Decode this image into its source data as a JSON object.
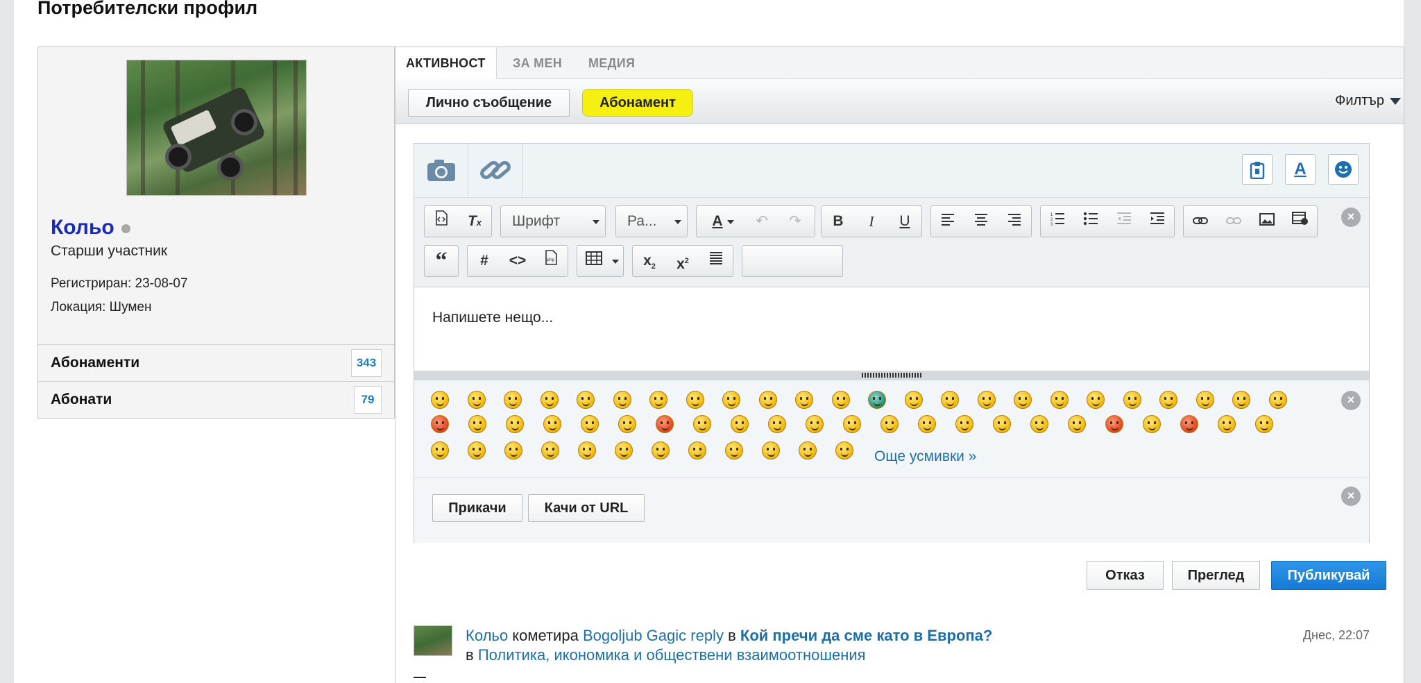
{
  "page": {
    "title": "Потребителски профил"
  },
  "profile": {
    "name": "Кольо",
    "rank": "Старши участник",
    "registered": "Регистриран: 23-08-07",
    "location": "Локация: Шумен",
    "stats": [
      {
        "label": "Абонаменти",
        "count": "343"
      },
      {
        "label": "Абонати",
        "count": "79"
      }
    ]
  },
  "tabs": [
    {
      "label": "АКТИВНОСТ"
    },
    {
      "label": "ЗА МЕН"
    },
    {
      "label": "МЕДИЯ"
    }
  ],
  "actions": {
    "private_message": "Лично съобщение",
    "subscribe": "Абонамент",
    "filter": "Филтър"
  },
  "editor": {
    "font_select": "Шрифт",
    "size_select": "Ра...",
    "placeholder": "Напишете нещо...",
    "more_smilies": "Още усмивки »",
    "attach": "Прикачи",
    "upload_url": "Качи от URL"
  },
  "post_buttons": {
    "cancel": "Отказ",
    "preview": "Преглед",
    "publish": "Публикувай"
  },
  "activity": {
    "user": "Кольо",
    "verb": "кометира",
    "target_user": "Bogoljub Gagic reply",
    "in1": "в",
    "thread": "Кой пречи да сме като в Европа?",
    "in2": "в",
    "forum": "Политика, икономика и обществени взаимоотношения",
    "time": "Днес, 22:07"
  },
  "colors": {
    "username": "#1a2bb8",
    "link": "#1d6fa8",
    "highlight": "#f5f012",
    "primary_button": "#1679d6"
  },
  "icons": {
    "camera": "camera-icon",
    "link": "link-icon",
    "clipboard": "clipboard-icon",
    "font_color": "font-color-icon",
    "smiley": "smiley-icon",
    "close": "close-icon"
  }
}
